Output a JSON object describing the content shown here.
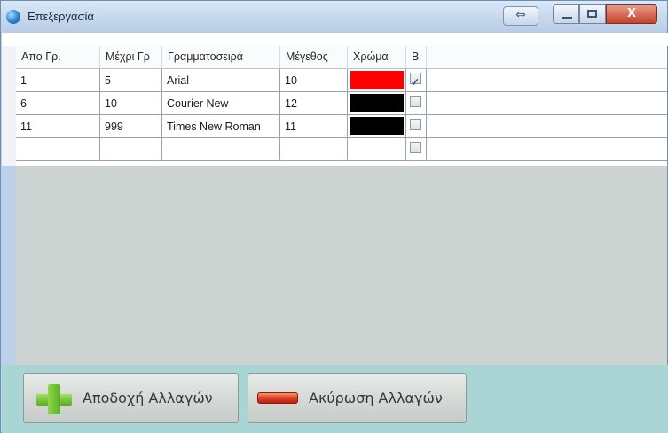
{
  "window": {
    "title": "Επεξεργασία"
  },
  "grid": {
    "columns": [
      "Απο Γρ.",
      "Μέχρι Γρ",
      "Γραμματοσειρά",
      "Μέγεθος",
      "Χρώμα",
      "B"
    ],
    "rows": [
      {
        "from": "1",
        "to": "5",
        "font": "Arial",
        "size": "10",
        "color": "#ff0000",
        "bold": true
      },
      {
        "from": "6",
        "to": "10",
        "font": "Courier New",
        "size": "12",
        "color": "#000000",
        "bold": false
      },
      {
        "from": "11",
        "to": "999",
        "font": "Times New Roman",
        "size": "11",
        "color": "#000000",
        "bold": false
      },
      {
        "from": "",
        "to": "",
        "font": "",
        "size": "",
        "color": "",
        "bold": false
      }
    ]
  },
  "buttons": {
    "accept_label": "Αποδοχή Αλλαγών",
    "cancel_label": "Ακύρωση Αλλαγών"
  }
}
